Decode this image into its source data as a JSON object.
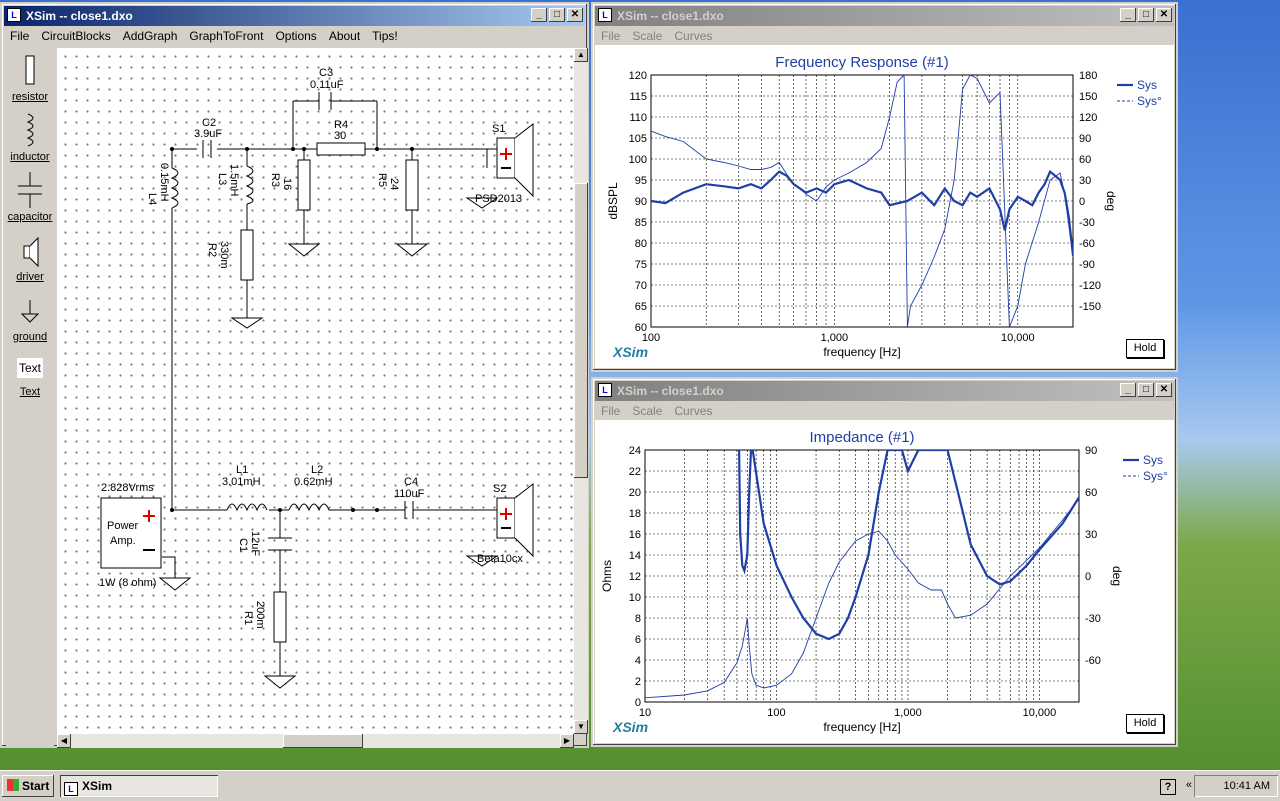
{
  "colors": {
    "curve": "#1f3ea6",
    "title_active": "#0a246a",
    "marker_red": "#e00000"
  },
  "main_window": {
    "title": "XSim -- close1.dxo",
    "menu": [
      "File",
      "CircuitBlocks",
      "AddGraph",
      "GraphToFront",
      "Options",
      "About",
      "Tips!"
    ]
  },
  "toolbox": {
    "resistor": "resistor",
    "inductor": "inductor",
    "capacitor": "capacitor",
    "driver": "driver",
    "ground": "ground",
    "text_box": "Text",
    "text": "Text"
  },
  "schematic": {
    "C3": "C3",
    "C3v": "0.11uF",
    "C2": "C2",
    "C2v": "3.9uF",
    "R4": "R4",
    "R4v": "30",
    "S1": "S1",
    "L4": "L4",
    "L4v": "0.15mH",
    "L3": "L3",
    "L3v": "1.5mH",
    "R3": "R3",
    "R3v": "16",
    "R5": "R5",
    "R5v": "24",
    "R2": "R2",
    "R2v": "330m",
    "S1v": "PSD2013",
    "src_label": "2.828Vrms",
    "amp1": "Power",
    "amp2": "Amp.",
    "amp_note": "1W (8 ohm)",
    "L1": "L1",
    "L1v": "3.01mH",
    "L2": "L2",
    "L2v": "0.62mH",
    "C4": "C4",
    "C4v": "110uF",
    "S2": "S2",
    "S2v": "Beta10cx",
    "C1": "C1",
    "C1v": "12uF",
    "R1": "R1",
    "R1v": "200m"
  },
  "freq_window": {
    "title": "XSim -- close1.dxo",
    "menu": [
      "File",
      "Scale",
      "Curves"
    ],
    "logo": "XSim",
    "hold": "Hold",
    "chart_data": {
      "type": "line",
      "title": "Frequency Response (#1)",
      "xlabel": "frequency [Hz]",
      "ylabel": "dBSPL",
      "y2label": "deg",
      "xscale": "log",
      "xlim": [
        100,
        20000
      ],
      "ylim": [
        60,
        120
      ],
      "y2lim": [
        -180,
        180
      ],
      "xticks": [
        "100",
        "1,000",
        "10,000"
      ],
      "yticks": [
        "60",
        "65",
        "70",
        "75",
        "80",
        "85",
        "90",
        "95",
        "100",
        "105",
        "110",
        "115",
        "120"
      ],
      "y2ticks": [
        "-150",
        "-120",
        "-90",
        "-60",
        "-30",
        "0",
        "30",
        "60",
        "90",
        "120",
        "150",
        "180"
      ],
      "legend": [
        "Sys",
        "Sys°"
      ],
      "series": [
        {
          "name": "Sys",
          "axis": "y",
          "x": [
            100,
            120,
            150,
            200,
            250,
            300,
            350,
            400,
            450,
            500,
            550,
            600,
            700,
            800,
            900,
            1000,
            1200,
            1500,
            1800,
            2000,
            2500,
            3000,
            3500,
            4000,
            4500,
            5000,
            5500,
            6000,
            7000,
            8000,
            8500,
            9000,
            10000,
            11000,
            12000,
            13000,
            14000,
            15000,
            16000,
            17000,
            18000,
            19000,
            20000
          ],
          "y": [
            90,
            89.5,
            92,
            94,
            93.5,
            93,
            94,
            93,
            95,
            97,
            96,
            94,
            92,
            93,
            92,
            94,
            95,
            93,
            92,
            89,
            90,
            92,
            89,
            93,
            90,
            89,
            92,
            91,
            93,
            88,
            83,
            88,
            91,
            90,
            89,
            92,
            94,
            97,
            96,
            95,
            92,
            86,
            77
          ]
        },
        {
          "name": "Sys°",
          "axis": "y2",
          "x": [
            100,
            120,
            150,
            200,
            250,
            300,
            350,
            400,
            450,
            500,
            550,
            600,
            700,
            800,
            900,
            1000,
            1200,
            1500,
            1800,
            2000,
            2200,
            2400,
            2500,
            2600,
            3000,
            3500,
            4000,
            4500,
            5000,
            5500,
            6000,
            7000,
            8000,
            9000,
            10000,
            11000,
            13000,
            15000,
            17000,
            18000,
            20000
          ],
          "y": [
            100,
            92,
            85,
            60,
            55,
            50,
            45,
            45,
            48,
            55,
            38,
            25,
            10,
            0,
            20,
            30,
            40,
            55,
            75,
            120,
            170,
            180,
            -180,
            -150,
            -120,
            -80,
            -40,
            30,
            160,
            180,
            175,
            140,
            155,
            -180,
            -150,
            -90,
            -30,
            30,
            40,
            10,
            -80
          ]
        }
      ]
    }
  },
  "imp_window": {
    "title": "XSim -- close1.dxo",
    "menu": [
      "File",
      "Scale",
      "Curves"
    ],
    "logo": "XSim",
    "hold": "Hold",
    "chart_data": {
      "type": "line",
      "title": "Impedance (#1)",
      "xlabel": "frequency [Hz]",
      "ylabel": "Ohms",
      "y2label": "deg",
      "xscale": "log",
      "xlim": [
        10,
        20000
      ],
      "ylim": [
        0,
        24
      ],
      "y2lim": [
        -90,
        90
      ],
      "xticks": [
        "10",
        "100",
        "1,000",
        "10,000"
      ],
      "yticks": [
        "0",
        "2",
        "4",
        "6",
        "8",
        "10",
        "12",
        "14",
        "16",
        "18",
        "20",
        "22",
        "24"
      ],
      "y2ticks": [
        "-60",
        "-30",
        "0",
        "30",
        "60",
        "90"
      ],
      "legend": [
        "Sys",
        "Sys°"
      ],
      "series": [
        {
          "name": "Sys",
          "axis": "y",
          "x": [
            52,
            53,
            55,
            57,
            60,
            62,
            64,
            66,
            80,
            100,
            130,
            160,
            200,
            250,
            300,
            350,
            400,
            500,
            600,
            700,
            800,
            900,
            1000,
            1200,
            1400,
            1600,
            1800,
            2000,
            2400,
            3000,
            4000,
            5000,
            6000,
            8000,
            10000,
            15000,
            20000
          ],
          "y": [
            24,
            16,
            13,
            12.5,
            14,
            20,
            24,
            24,
            17,
            13,
            10,
            8,
            6.5,
            6,
            6.5,
            8,
            10,
            14,
            20,
            24,
            24,
            24,
            22,
            24,
            24,
            24,
            24,
            24,
            20,
            15,
            12,
            11.2,
            11.5,
            13,
            14.5,
            17,
            19.5
          ]
        },
        {
          "name": "Sys°",
          "axis": "y2",
          "x": [
            10,
            20,
            30,
            40,
            50,
            55,
            58,
            60,
            62,
            65,
            70,
            80,
            100,
            130,
            160,
            200,
            250,
            300,
            400,
            500,
            600,
            700,
            800,
            1000,
            1200,
            1500,
            1800,
            2000,
            2300,
            3000,
            4000,
            6000,
            10000,
            15000,
            20000
          ],
          "y": [
            -87,
            -85,
            -82,
            -76,
            -62,
            -50,
            -38,
            -30,
            -50,
            -70,
            -78,
            -80,
            -78,
            -70,
            -55,
            -30,
            -5,
            10,
            25,
            30,
            32,
            25,
            15,
            5,
            -5,
            -10,
            -10,
            -20,
            -30,
            -28,
            -20,
            0,
            20,
            40,
            55
          ]
        }
      ]
    }
  },
  "taskbar": {
    "start": "Start",
    "task": "XSim",
    "time": "10:41 AM"
  }
}
